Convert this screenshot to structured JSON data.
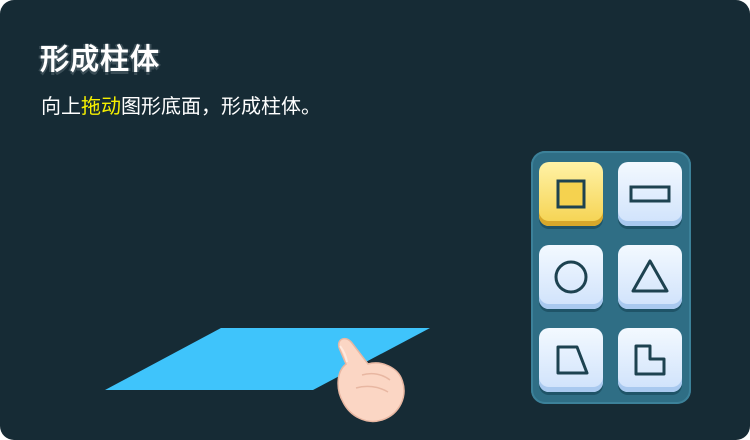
{
  "lesson": {
    "title": "形成柱体",
    "instruction_before": "向上",
    "instruction_highlight": "拖动",
    "instruction_after": "图形底面，形成柱体。"
  },
  "colors": {
    "background": "#162b35",
    "highlight_text": "#f6f000",
    "base_shape": "#3fc4fb",
    "palette_panel": "#2f6e85",
    "tile": "#dcecff",
    "tile_selected": "#f5d24f",
    "shape_outline": "#1d4250"
  },
  "shape_palette": {
    "selected": "square",
    "tiles": [
      {
        "shape": "square",
        "icon": "square-icon"
      },
      {
        "shape": "rectangle",
        "icon": "rectangle-icon"
      },
      {
        "shape": "circle",
        "icon": "circle-icon"
      },
      {
        "shape": "triangle",
        "icon": "triangle-icon"
      },
      {
        "shape": "trapezoid",
        "icon": "trapezoid-icon"
      },
      {
        "shape": "l-shape",
        "icon": "l-shape-icon"
      }
    ]
  },
  "drag_hint": {
    "icon": "pointing-hand-icon"
  }
}
